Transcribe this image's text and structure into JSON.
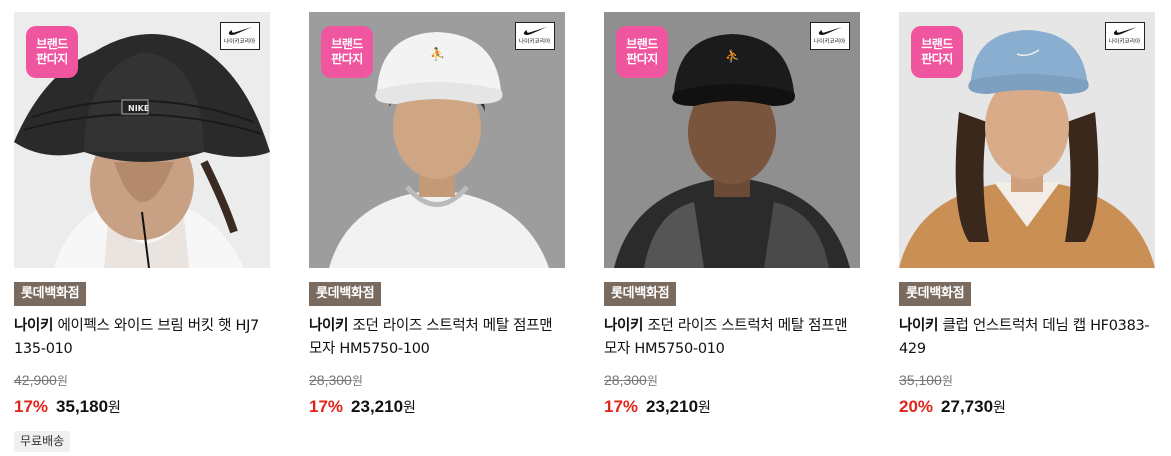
{
  "badges": {
    "brand_line1": "브랜드",
    "brand_line2": "판다지",
    "nike_korea": "나이키코리아"
  },
  "colors": {
    "store_tag_bg": "#796b60",
    "discount_red": "#e0231b",
    "brand_badge_pink": "#f0559f"
  },
  "products": [
    {
      "store": "롯데백화점",
      "brand": "나이키",
      "name": "에이펙스 와이드 브림 버킷 햇 HJ7135-010",
      "original_price": "42,900",
      "discount": "17%",
      "price": "35,180",
      "currency": "원",
      "shipping": "무료배송"
    },
    {
      "store": "롯데백화점",
      "brand": "나이키",
      "name": "조던 라이즈 스트럭처 메탈 점프맨 모자 HM5750-100",
      "original_price": "28,300",
      "discount": "17%",
      "price": "23,210",
      "currency": "원"
    },
    {
      "store": "롯데백화점",
      "brand": "나이키",
      "name": "조던 라이즈 스트럭처 메탈 점프맨 모자 HM5750-010",
      "original_price": "28,300",
      "discount": "17%",
      "price": "23,210",
      "currency": "원"
    },
    {
      "store": "롯데백화점",
      "brand": "나이키",
      "name": "클럽 언스트럭처 데님 캡 HF0383-429",
      "original_price": "35,100",
      "discount": "20%",
      "price": "27,730",
      "currency": "원"
    }
  ]
}
